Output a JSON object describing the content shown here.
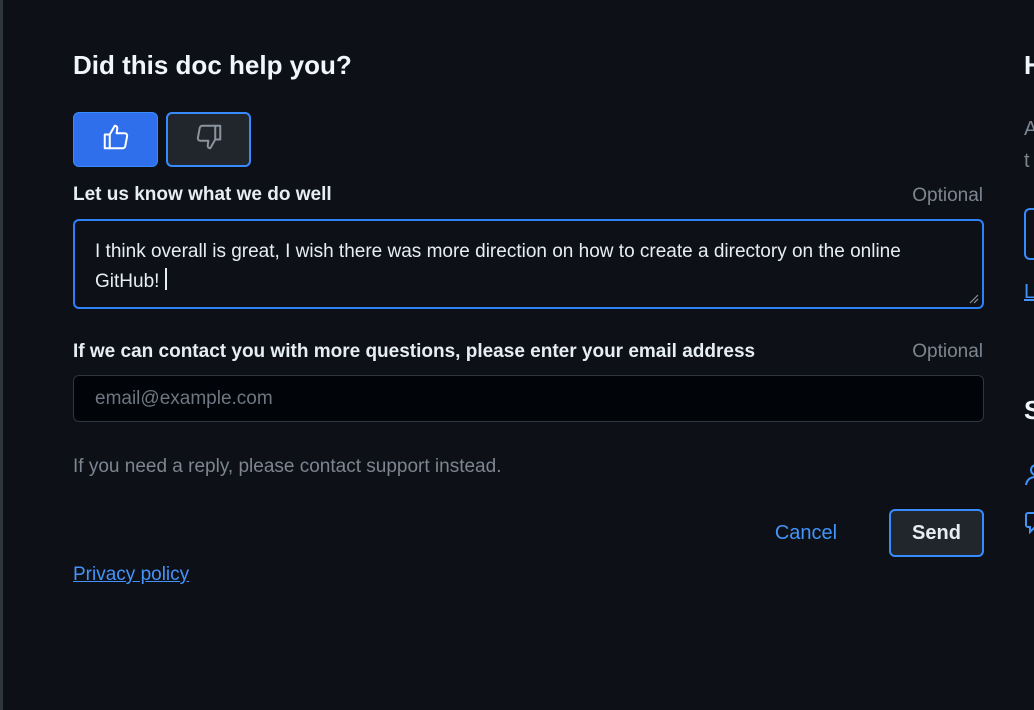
{
  "feedback": {
    "title": "Did this doc help you?",
    "thumbs_up_icon": "thumbs-up-icon",
    "thumbs_down_icon": "thumbs-down-icon",
    "well_label": "Let us know what we do well",
    "well_optional": "Optional",
    "well_value": "I think overall is great, I wish there was more direction on how to create a directory on the online GitHub!",
    "email_label": "If we can contact you with more questions, please enter your email address",
    "email_optional": "Optional",
    "email_placeholder": "email@example.com",
    "hint": "If you need a reply, please contact support instead.",
    "cancel_label": "Cancel",
    "send_label": "Send",
    "privacy_label": "Privacy policy"
  },
  "sidebar_clipped": {
    "heading_1": "H",
    "line_1": "A",
    "line_2": "t",
    "link": "L",
    "heading_2": "S"
  },
  "colors": {
    "background": "#0d1117",
    "accent": "#2f81f7",
    "link": "#4493f8",
    "muted": "#7d8590"
  }
}
